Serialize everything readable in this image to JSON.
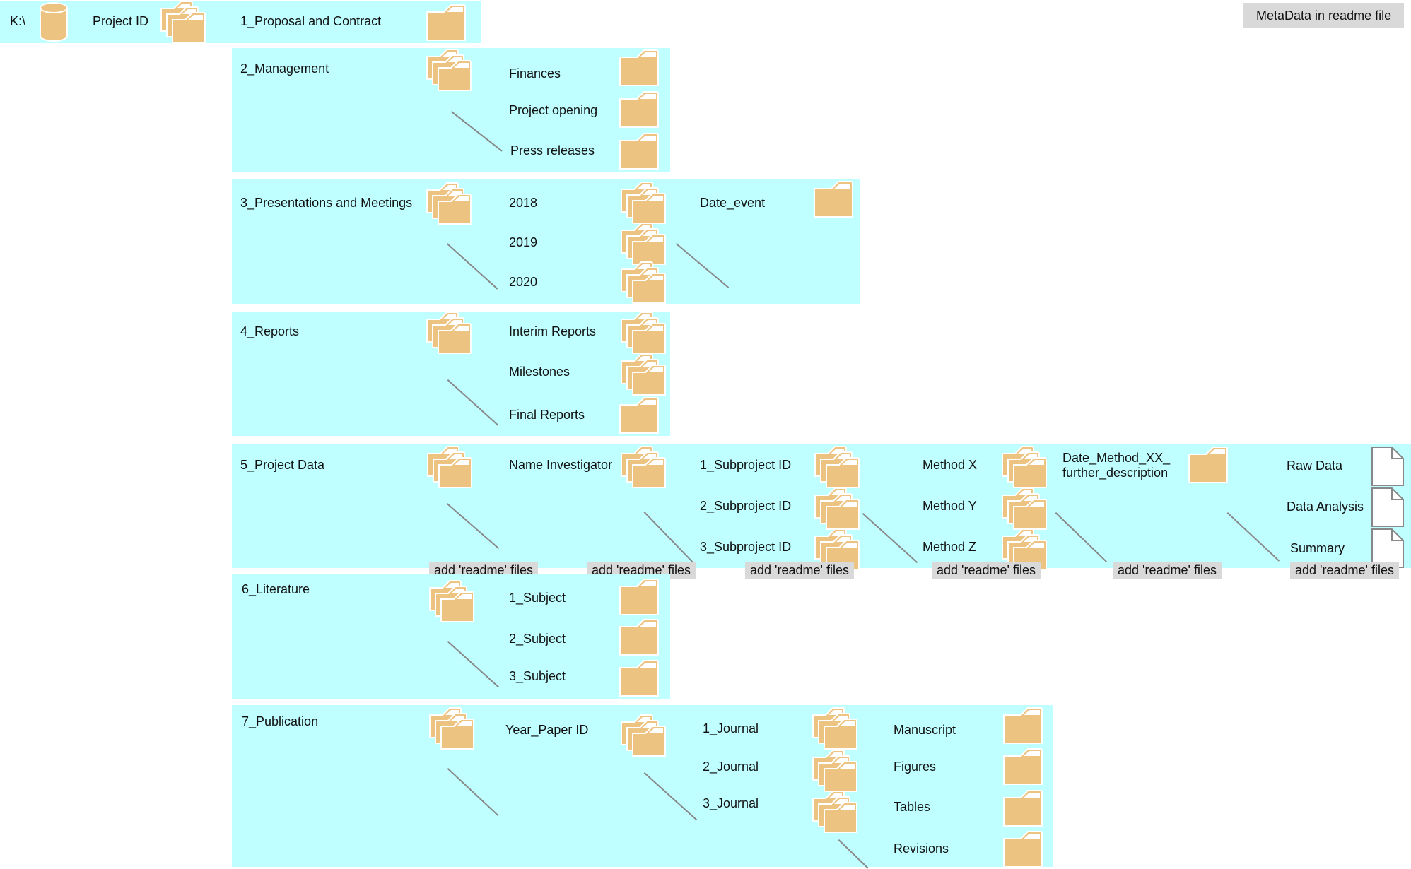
{
  "legend": {
    "metadata_label": "MetaData in readme file"
  },
  "root": {
    "drive_label": "K:\\",
    "project_label": "Project ID",
    "first_folder": "1_Proposal and Contract"
  },
  "sections": {
    "management": {
      "title": "2_Management",
      "children": [
        "Finances",
        "Project opening",
        "Press releases"
      ]
    },
    "presentations": {
      "title": "3_Presentations and Meetings",
      "children": [
        "2018",
        "2019",
        "2020"
      ],
      "sub": "Date_event"
    },
    "reports": {
      "title": "4_Reports",
      "children": [
        "Interim Reports",
        "Milestones",
        "Final Reports"
      ]
    },
    "project_data": {
      "title": "5_Project Data",
      "investigator": "Name Investigator",
      "subprojects": [
        "1_Subproject ID",
        "2_Subproject ID",
        "3_Subproject ID"
      ],
      "methods": [
        "Method X",
        "Method Y",
        "Method Z"
      ],
      "date_method": "Date_Method_XX_\nfurther_description",
      "date_method_line1": "Date_Method_XX_",
      "date_method_line2": "further_description",
      "files": [
        "Raw Data",
        "Data Analysis",
        "Summary"
      ],
      "readme_tag": "add 'readme' files"
    },
    "literature": {
      "title": "6_Literature",
      "children": [
        "1_Subject",
        "2_Subject",
        "3_Subject"
      ]
    },
    "publication": {
      "title": "7_Publication",
      "paper": "Year_Paper ID",
      "journals": [
        "1_Journal",
        "2_Journal",
        "3_Journal"
      ],
      "contents": [
        "Manuscript",
        "Figures",
        "Tables",
        "Revisions"
      ]
    }
  },
  "colors": {
    "box": "#bfffff",
    "folder": "#edc382",
    "tag": "#d9d9d9",
    "connector": "#888888"
  }
}
